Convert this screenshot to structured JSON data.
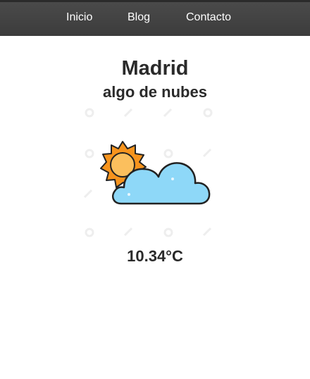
{
  "nav": {
    "items": [
      {
        "label": "Inicio"
      },
      {
        "label": "Blog"
      },
      {
        "label": "Contacto"
      }
    ]
  },
  "weather": {
    "city": "Madrid",
    "description": "algo de nubes",
    "icon": "sun-behind-cloud-icon",
    "temperature": "10.34°C"
  },
  "colors": {
    "navbar": "#444444",
    "sun": "#f7941d",
    "sun_core": "#fbbf5d",
    "cloud": "#8ed8f8",
    "text": "#2a2a2a"
  }
}
